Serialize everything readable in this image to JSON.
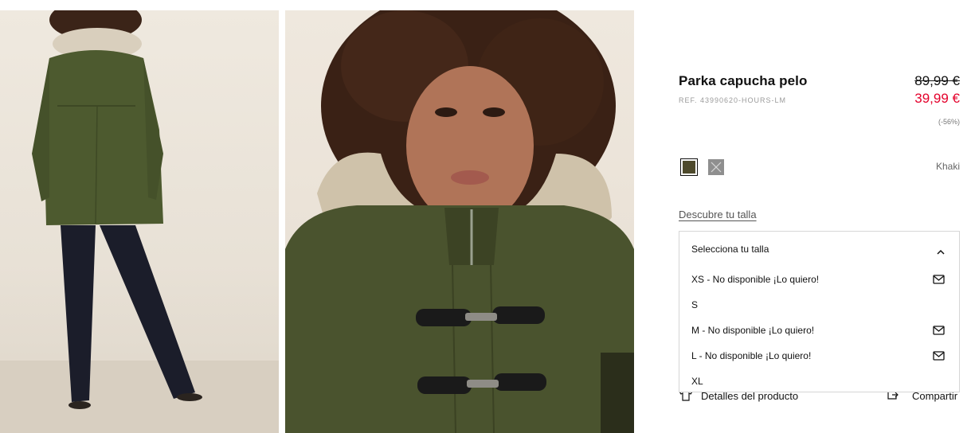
{
  "product": {
    "title": "Parka capucha pelo",
    "reference": "REF. 43990620-HOURS-LM",
    "price_original": "89,99 €",
    "price_sale": "39,99 €",
    "discount": "(-56%)"
  },
  "colors": {
    "selected_name": "Khaki",
    "swatches": [
      {
        "name": "khaki",
        "hex": "#4e4a2c",
        "selected": true
      },
      {
        "name": "grey",
        "hex": "#8f8f8f",
        "selected": false
      }
    ]
  },
  "size_guide_link": "Descubre tu talla",
  "size_dropdown": {
    "placeholder": "Selecciona tu talla",
    "expanded": true,
    "options": [
      {
        "label": "XS - No disponible ¡Lo quiero!",
        "available": false,
        "icon": "mail-icon"
      },
      {
        "label": "S",
        "available": true
      },
      {
        "label": "M - No disponible ¡Lo quiero!",
        "available": false,
        "icon": "mail-icon"
      },
      {
        "label": "L - No disponible ¡Lo quiero!",
        "available": false,
        "icon": "mail-icon"
      },
      {
        "label": "XL",
        "available": true
      }
    ]
  },
  "actions": {
    "details_label": "Detalles del producto",
    "share_label": "Compartir"
  },
  "theme": {
    "sale_color": "#e4002b",
    "text_color": "#111111"
  }
}
